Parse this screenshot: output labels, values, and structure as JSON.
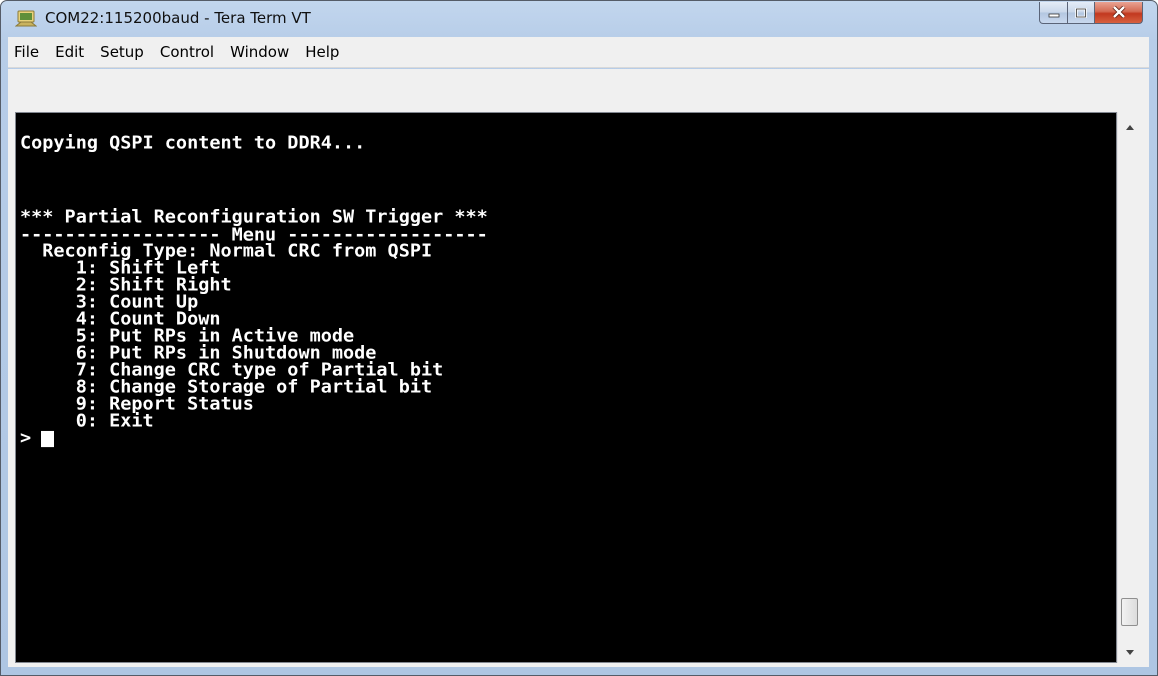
{
  "window": {
    "title": "COM22:115200baud - Tera Term VT",
    "app_icon": "tera-term-icon"
  },
  "caption_buttons": {
    "minimize_icon": "minimize-icon",
    "maximize_icon": "maximize-icon",
    "close_icon": "close-icon"
  },
  "menubar": {
    "items": [
      "File",
      "Edit",
      "Setup",
      "Control",
      "Window",
      "Help"
    ]
  },
  "terminal": {
    "background": "#000000",
    "foreground": "#ffffff",
    "lines": [
      "Copying QSPI content to DDR4...",
      "*** Partial Reconfiguration SW Trigger ***",
      "------------------ Menu ------------------",
      "  Reconfig Type: Normal CRC from QSPI",
      "     1: Shift Left",
      "     2: Shift Right",
      "     3: Count Up",
      "     4: Count Down",
      "     5: Put RPs in Active mode",
      "     6: Put RPs in Shutdown mode",
      "     7: Change CRC type of Partial bit",
      "     8: Change Storage of Partial bit",
      "     9: Report Status",
      "     0: Exit"
    ],
    "prompt": ">"
  },
  "scrollbar": {
    "up_icon": "scroll-up-arrow-icon",
    "down_icon": "scroll-down-arrow-icon"
  }
}
